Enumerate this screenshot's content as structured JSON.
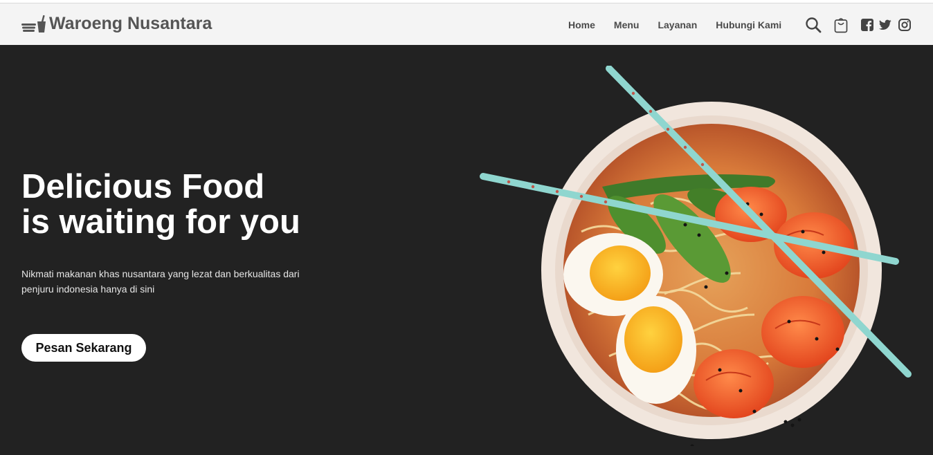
{
  "header": {
    "brand_name": "Waroeng Nusantara",
    "nav": [
      {
        "label": "Home"
      },
      {
        "label": "Menu"
      },
      {
        "label": "Layanan"
      },
      {
        "label": "Hubungi Kami"
      }
    ],
    "icons": [
      "search-icon",
      "shopping-bag-icon",
      "facebook-icon",
      "twitter-icon",
      "instagram-icon"
    ]
  },
  "hero": {
    "title_line1": "Delicious Food",
    "title_line2": "is waiting for you",
    "description": "Nikmati makanan khas nusantara yang lezat dan berkualitas dari penjuru indonesia hanya di sini",
    "cta_label": "Pesan Sekarang",
    "image": "ramen-bowl-with-eggs-shrimp-and-chopsticks"
  },
  "colors": {
    "hero_background": "#222222",
    "navbar_background": "#f4f4f4",
    "nav_text": "#4a4a4a",
    "brand_text": "#555555",
    "cta_background": "#ffffff",
    "chopstick": "#8fd6cf"
  }
}
